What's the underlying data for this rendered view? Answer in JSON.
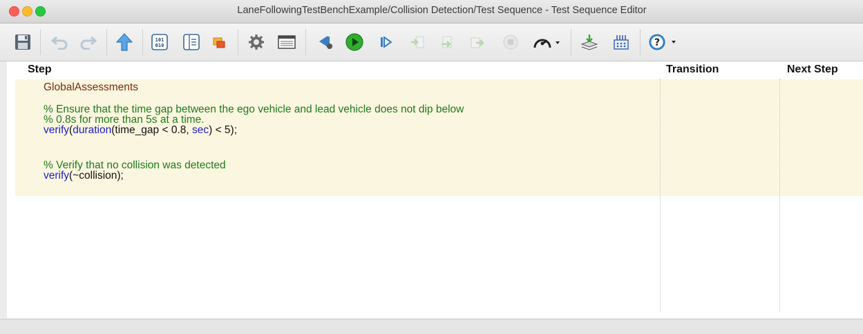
{
  "window": {
    "title": "LaneFollowingTestBenchExample/Collision Detection/Test Sequence - Test Sequence Editor"
  },
  "toolbar": {
    "buttons": [
      {
        "name": "save-icon",
        "enabled": true
      },
      {
        "name": "undo-icon",
        "enabled": false
      },
      {
        "name": "redo-icon",
        "enabled": false
      },
      {
        "name": "up-arrow-icon",
        "enabled": true
      },
      {
        "name": "data-symbols-icon",
        "enabled": true
      },
      {
        "name": "symbols-pane-icon",
        "enabled": true
      },
      {
        "name": "edit-data-icon",
        "enabled": true
      },
      {
        "name": "settings-gear-icon",
        "enabled": true
      },
      {
        "name": "data-inspector-icon",
        "enabled": true
      },
      {
        "name": "step-back-icon",
        "enabled": true
      },
      {
        "name": "run-icon",
        "enabled": true
      },
      {
        "name": "step-forward-icon",
        "enabled": true
      },
      {
        "name": "step-in-icon",
        "enabled": false
      },
      {
        "name": "step-over-icon",
        "enabled": false
      },
      {
        "name": "step-out-icon",
        "enabled": false
      },
      {
        "name": "stop-icon",
        "enabled": false
      },
      {
        "name": "simulation-pacing-icon",
        "enabled": true
      },
      {
        "name": "deploy-icon",
        "enabled": true
      },
      {
        "name": "test-harness-icon",
        "enabled": true
      },
      {
        "name": "help-icon",
        "enabled": true
      }
    ],
    "colors": {
      "run": "#2fae2f",
      "arrow_blue": "#3a8fd6"
    }
  },
  "table": {
    "headers": {
      "step": "Step",
      "transition": "Transition",
      "next_step": "Next Step"
    },
    "step": {
      "name": "GlobalAssessments",
      "comment1_line1": "% Ensure that the time gap between the ego vehicle and lead vehicle does not dip below",
      "comment1_line2": "% 0.8s for more than 5s at a time.",
      "verify1": {
        "kw_verify": "verify",
        "paren_open": "(",
        "kw_duration": "duration",
        "expr": "(time_gap < 0.8, ",
        "kw_sec": "sec",
        "tail": ") < 5);"
      },
      "comment2": "% Verify that no collision was detected",
      "verify2": {
        "kw_verify": "verify",
        "tail": "(~collision);"
      }
    }
  },
  "colors": {
    "step_row_bg": "#fbf6df",
    "step_name": "#7a2a16",
    "comment": "#1f7a1f",
    "keyword": "#2020c8"
  }
}
